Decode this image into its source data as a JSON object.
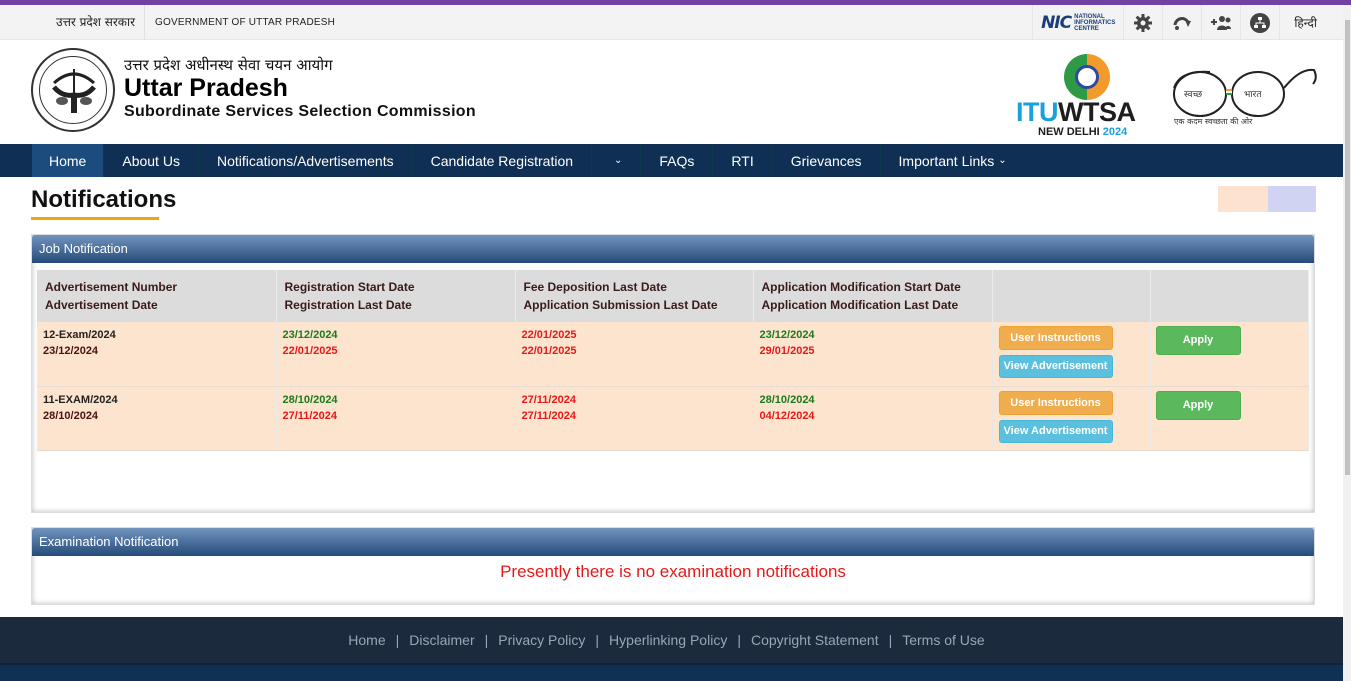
{
  "govbar": {
    "hindi_label": "उत्तर प्रदेश सरकार",
    "english_label": "GOVERNMENT OF UTTAR PRADESH",
    "nic_mark": "NIC",
    "nic_text": [
      "NATIONAL",
      "INFORMATICS",
      "CENTRE"
    ],
    "icons": [
      "settings-icon",
      "skip-to-content-icon",
      "accessibility-users-icon",
      "sitemap-icon"
    ],
    "language_link": "हिन्दी"
  },
  "header": {
    "hindi_title": "उत्तर प्रदेश अधीनस्थ सेवा चयन आयोग",
    "title": "Uttar Pradesh",
    "subtitle": "Subordinate Services Selection Commission",
    "itu": {
      "word_a": "ITU",
      "word_b": "WTSA",
      "city": "NEW DELHI",
      "year": "2024"
    },
    "swachh": {
      "left": "स्वच्छ",
      "right": "भारत",
      "tagline": "एक कदम स्वच्छता की ओर"
    }
  },
  "nav": {
    "items": [
      {
        "label": "Home",
        "active": true
      },
      {
        "label": "About Us"
      },
      {
        "label": "Notifications/Advertisements"
      },
      {
        "label": "Candidate Registration"
      },
      {
        "label": ""
      },
      {
        "label": "FAQs"
      },
      {
        "label": "RTI"
      },
      {
        "label": "Grievances"
      },
      {
        "label": "Important Links"
      }
    ]
  },
  "page": {
    "title": "Notifications",
    "colors": {
      "swatch_1": "#fde3cf",
      "swatch_2": "#d1d3f3"
    }
  },
  "job_notification": {
    "heading": "Job Notification",
    "headers": [
      [
        "Advertisement Number",
        "Advertisement Date"
      ],
      [
        "Registration Start Date",
        "Registration Last Date"
      ],
      [
        "Fee Deposition Last Date",
        "Application Submission Last Date"
      ],
      [
        "Application Modification Start Date",
        "Application Modification Last Date"
      ],
      [
        "",
        ""
      ],
      [
        "",
        ""
      ]
    ],
    "rows": [
      {
        "adv_number": "12-Exam/2024",
        "adv_date": "23/12/2024",
        "reg_start": "23/12/2024",
        "reg_last": "22/01/2025",
        "fee_last": "22/01/2025",
        "submission_last": "22/01/2025",
        "mod_start": "23/12/2024",
        "mod_last": "29/01/2025",
        "user_instructions": "User Instructions",
        "view_advertisement": "View Advertisement",
        "apply": "Apply"
      },
      {
        "adv_number": "11-EXAM/2024",
        "adv_date": "28/10/2024",
        "reg_start": "28/10/2024",
        "reg_last": "27/11/2024",
        "fee_last": "27/11/2024",
        "submission_last": "27/11/2024",
        "mod_start": "28/10/2024",
        "mod_last": "04/12/2024",
        "user_instructions": "User Instructions",
        "view_advertisement": "View Advertisement",
        "apply": "Apply"
      }
    ]
  },
  "exam_notification": {
    "heading": "Examination Notification",
    "message": "Presently there is no examination notifications"
  },
  "footer": {
    "links": [
      "Home",
      "Disclaimer",
      "Privacy Policy",
      "Hyperlinking Policy",
      "Copyright Statement",
      "Terms of Use"
    ],
    "separator": "|"
  }
}
